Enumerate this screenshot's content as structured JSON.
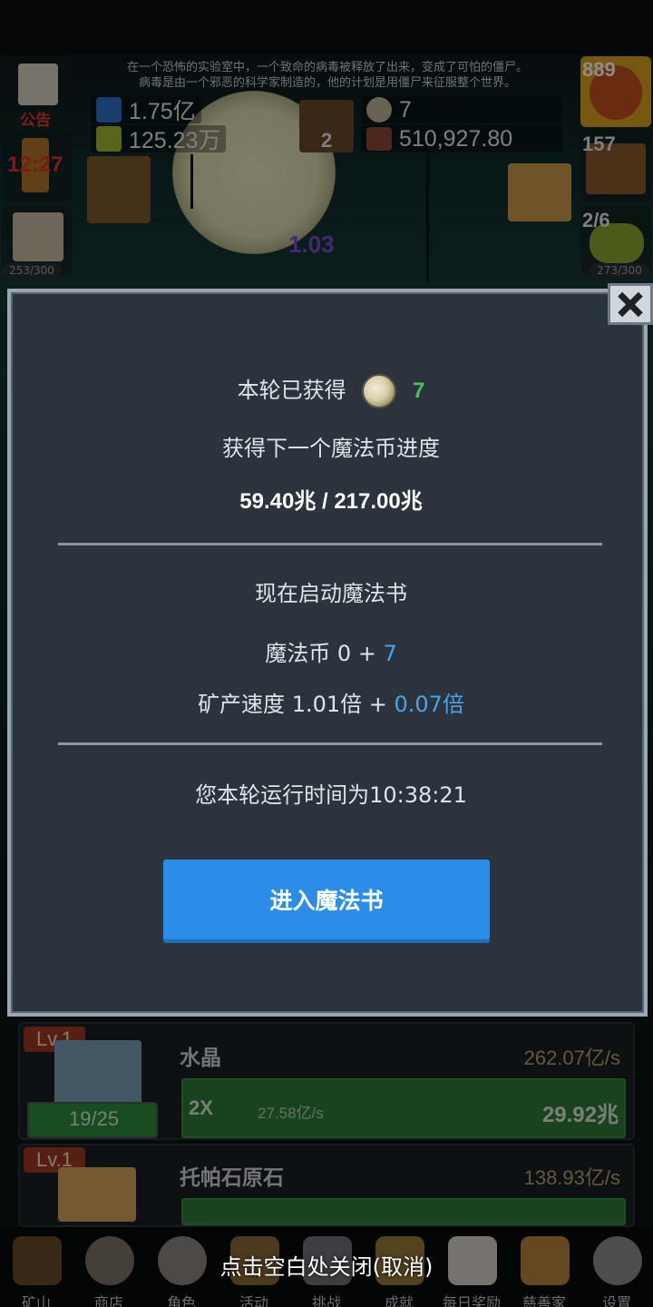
{
  "news_ticker": {
    "line1": "在一个恐怖的实验室中，一个致命的病毒被释放了出来，变成了可怕的僵尸。",
    "line2": "病毒是由一个邪恶的科学家制造的，他的计划是用僵尸来征服整个世界。"
  },
  "left_panel": {
    "notice_label": "公告",
    "time_label": "12:27",
    "capacity_label": "253/300"
  },
  "resources": {
    "blue_potion": "1.75亿",
    "green_potion": "125.23万",
    "book_count": "2",
    "coin_count": "7",
    "meat_count": "510,927.80"
  },
  "right_panel": {
    "potion_count": "889",
    "chest_count": "157",
    "progress_label": "2/6",
    "capacity_label": "273/300"
  },
  "scene_text": {
    "floating_label": "1.03"
  },
  "modal": {
    "earned_label": "本轮已获得",
    "earned_value": "7",
    "next_progress_label": "获得下一个魔法币进度",
    "progress_value": "59.40兆 / 217.00兆",
    "start_label": "现在启动魔法书",
    "coin_line_prefix": "魔法币 0 + ",
    "coin_line_bonus": "7",
    "speed_line_prefix": "矿产速度 1.01倍 + ",
    "speed_line_bonus": "0.07倍",
    "runtime_label": "您本轮运行时间为10:38:21",
    "enter_button": "进入魔法书"
  },
  "cards": [
    {
      "level": "Lv.1",
      "name": "水晶",
      "rate": "262.07亿/s",
      "progress": "19/25",
      "multiplier": "2X",
      "sub_rate": "27.58亿/s",
      "total": "29.92兆"
    },
    {
      "level": "Lv.1",
      "name": "托帕石原石",
      "rate": "138.93亿/s"
    }
  ],
  "dismiss_hint": "点击空白处关闭(取消)",
  "nav": [
    {
      "label": "矿山"
    },
    {
      "label": "商店"
    },
    {
      "label": "角色"
    },
    {
      "label": "活动"
    },
    {
      "label": "挑战"
    },
    {
      "label": "成就"
    },
    {
      "label": "每日奖励"
    },
    {
      "label": "慈善家"
    },
    {
      "label": "设置"
    }
  ],
  "colors": {
    "accent": "#2b8de8",
    "green": "#4cc05a",
    "blue": "#4aa3e8",
    "level_badge": "#9b3a22"
  }
}
